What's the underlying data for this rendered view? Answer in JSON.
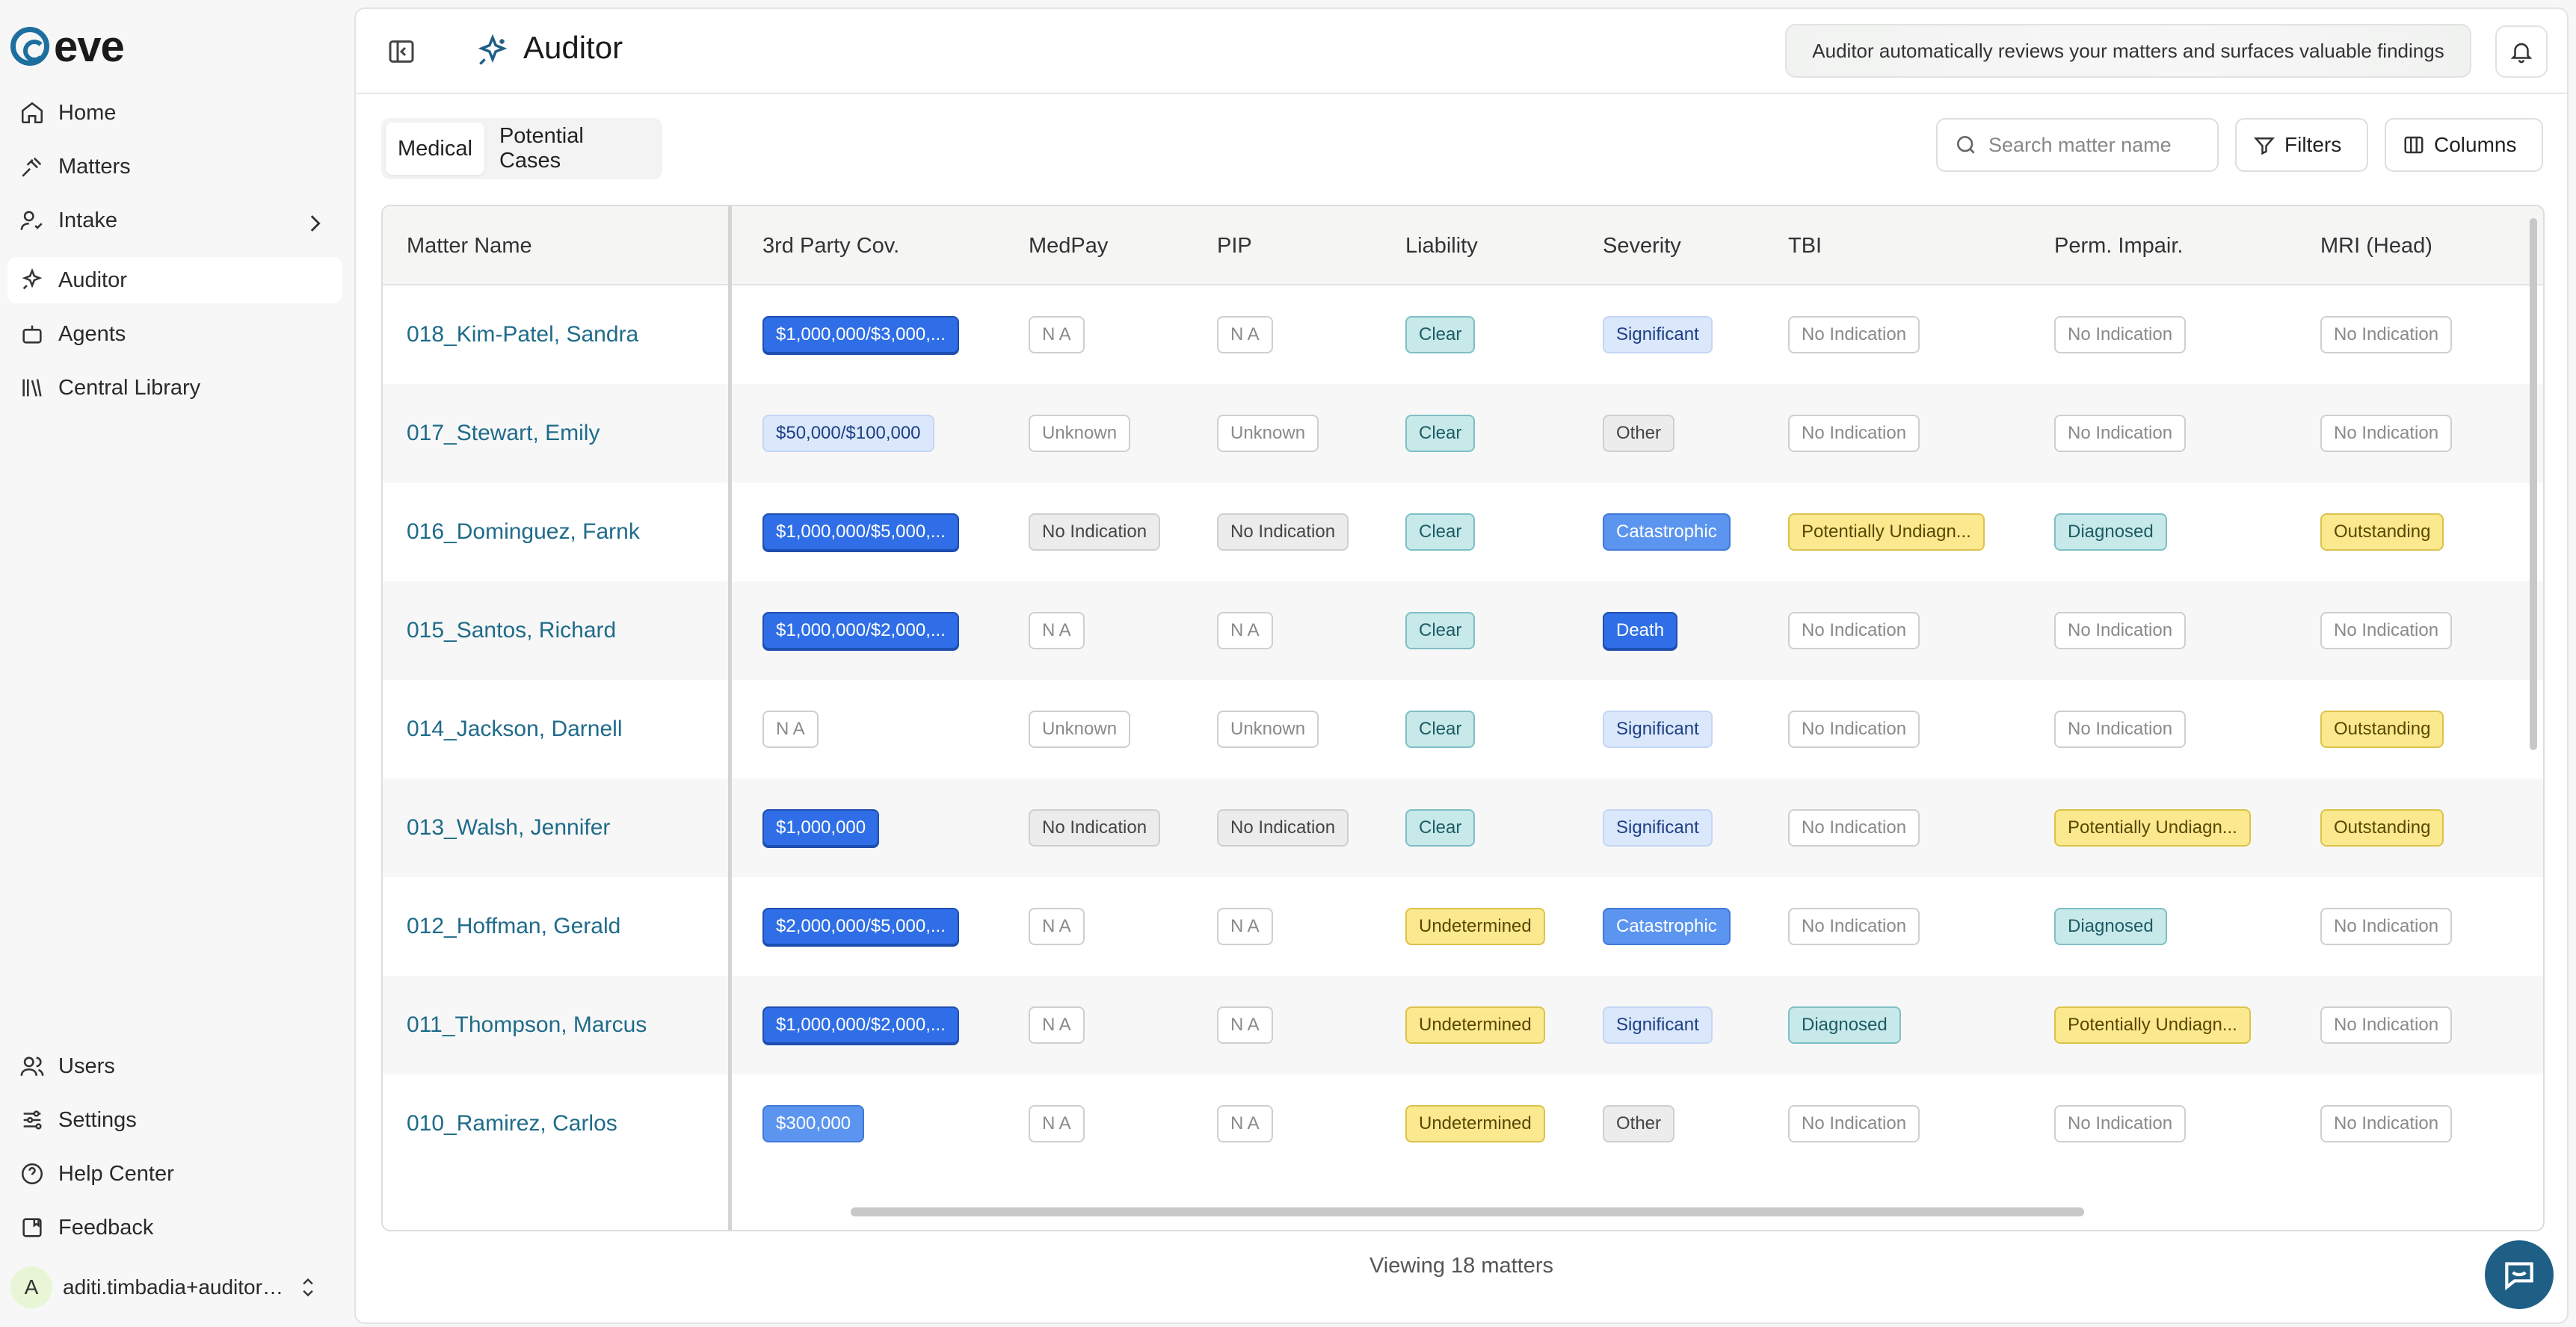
{
  "app": {
    "logo_text": "eve"
  },
  "sidebar": {
    "items": [
      {
        "label": "Home",
        "icon": "home-icon"
      },
      {
        "label": "Matters",
        "icon": "gavel-icon"
      },
      {
        "label": "Intake",
        "icon": "intake-icon"
      },
      {
        "label": "Auditor",
        "icon": "sparkle-icon",
        "active": true
      },
      {
        "label": "Agents",
        "icon": "agent-icon"
      },
      {
        "label": "Central Library",
        "icon": "library-icon"
      }
    ],
    "bottom_items": [
      {
        "label": "Users",
        "icon": "users-icon"
      },
      {
        "label": "Settings",
        "icon": "settings-icon"
      },
      {
        "label": "Help Center",
        "icon": "help-icon"
      },
      {
        "label": "Feedback",
        "icon": "feedback-icon"
      }
    ],
    "user": {
      "initial": "A",
      "name": "aditi.timbadia+auditor…"
    }
  },
  "header": {
    "title": "Auditor",
    "banner": "Auditor automatically reviews your matters and surfaces valuable findings"
  },
  "tabs": [
    "Medical",
    "Potential Cases"
  ],
  "toolbar": {
    "search_placeholder": "Search matter name",
    "filters_label": "Filters",
    "columns_label": "Columns"
  },
  "table": {
    "columns": [
      "Matter Name",
      "3rd Party Cov.",
      "MedPay",
      "PIP",
      "Liability",
      "Severity",
      "TBI",
      "Perm. Impair.",
      "MRI (Head)"
    ],
    "rows": [
      [
        "018_Kim-Patel, Sandra",
        "$1,000,000/$3,000,...",
        "N A",
        "N A",
        "Clear",
        "Significant",
        "No Indication",
        "No Indication",
        "No Indication"
      ],
      [
        "017_Stewart, Emily",
        "$50,000/$100,000",
        "Unknown",
        "Unknown",
        "Clear",
        "Other",
        "No Indication",
        "No Indication",
        "No Indication"
      ],
      [
        "016_Dominguez, Farnk",
        "$1,000,000/$5,000,...",
        "No Indication",
        "No Indication",
        "Clear",
        "Catastrophic",
        "Potentially Undiagn...",
        "Diagnosed",
        "Outstanding"
      ],
      [
        "015_Santos, Richard",
        "$1,000,000/$2,000,...",
        "N A",
        "N A",
        "Clear",
        "Death",
        "No Indication",
        "No Indication",
        "No Indication"
      ],
      [
        "014_Jackson, Darnell",
        "N A",
        "Unknown",
        "Unknown",
        "Clear",
        "Significant",
        "No Indication",
        "No Indication",
        "Outstanding"
      ],
      [
        "013_Walsh, Jennifer",
        "$1,000,000",
        "No Indication",
        "No Indication",
        "Clear",
        "Significant",
        "No Indication",
        "Potentially Undiagn...",
        "Outstanding"
      ],
      [
        "012_Hoffman, Gerald",
        "$2,000,000/$5,000,...",
        "N A",
        "N A",
        "Undetermined",
        "Catastrophic",
        "No Indication",
        "Diagnosed",
        "No Indication"
      ],
      [
        "011_Thompson, Marcus",
        "$1,000,000/$2,000,...",
        "N A",
        "N A",
        "Undetermined",
        "Significant",
        "Diagnosed",
        "Potentially Undiagn...",
        "No Indication"
      ],
      [
        "010_Ramirez, Carlos",
        "$300,000",
        "N A",
        "N A",
        "Undetermined",
        "Other",
        "No Indication",
        "No Indication",
        "No Indication"
      ]
    ]
  },
  "footer": {
    "count_text": "Viewing 18 matters"
  },
  "colors": {
    "link": "#1f6b8a",
    "coverage_blue": "#2f6ee6",
    "teal_badge": "#c7e9ea",
    "yellow_badge": "#fbe98f",
    "chat_button": "#1f5f86"
  }
}
